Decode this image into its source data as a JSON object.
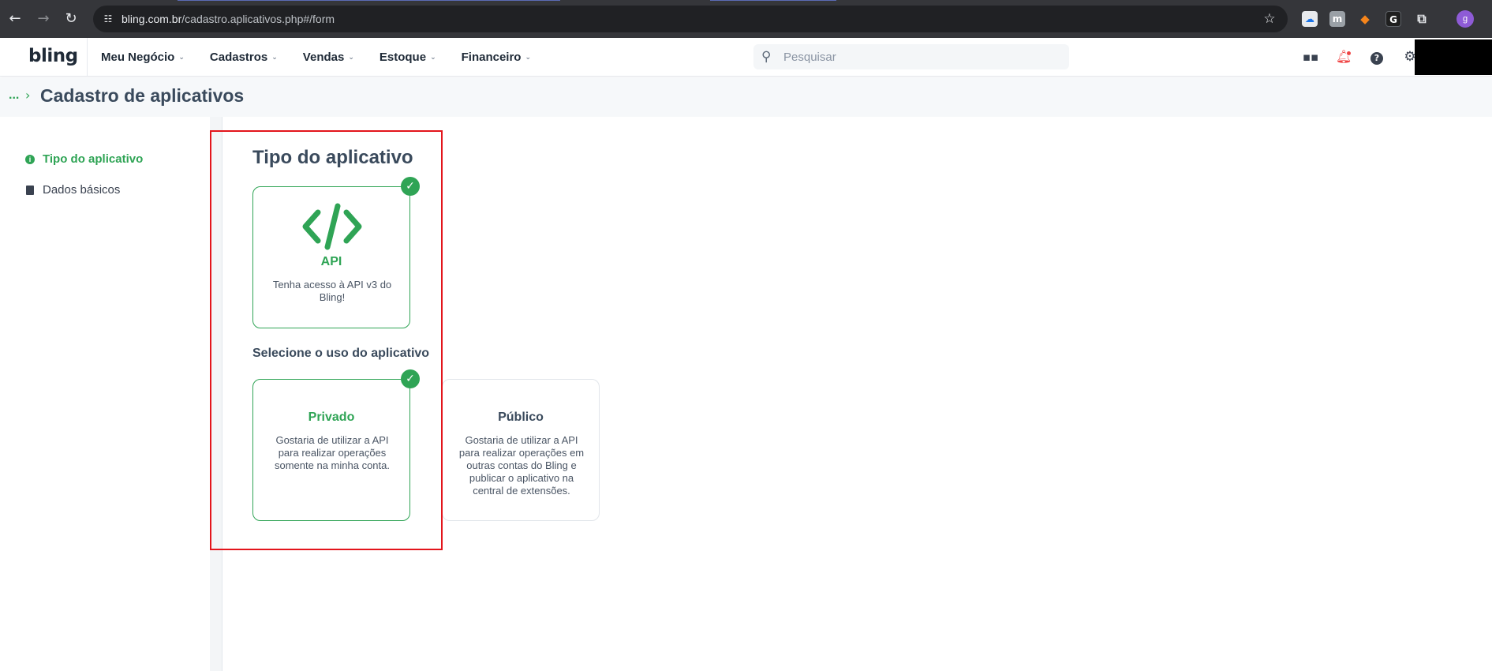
{
  "browser": {
    "url_host": "bling.com.br",
    "url_path": "/cadastro.aplicativos.php#/form",
    "profile_initial": "g"
  },
  "header": {
    "logo": "bling",
    "menu": [
      {
        "label": "Meu Negócio"
      },
      {
        "label": "Cadastros"
      },
      {
        "label": "Vendas"
      },
      {
        "label": "Estoque"
      },
      {
        "label": "Financeiro"
      }
    ],
    "search_placeholder": "Pesquisar"
  },
  "breadcrumb": {
    "ellipsis": "...",
    "title": "Cadastro de aplicativos"
  },
  "sidebar": {
    "items": [
      {
        "label": "Tipo do aplicativo",
        "active": true
      },
      {
        "label": "Dados básicos",
        "active": false
      }
    ]
  },
  "main": {
    "section_title": "Tipo do aplicativo",
    "type_cards": [
      {
        "title": "API",
        "description": "Tenha acesso à API v3 do Bling!",
        "selected": true
      }
    ],
    "usage_title": "Selecione o uso do aplicativo",
    "usage_cards": [
      {
        "title": "Privado",
        "description": "Gostaria de utilizar a API para realizar operações somente na minha conta.",
        "selected": true
      },
      {
        "title": "Público",
        "description": "Gostaria de utilizar a API para realizar operações em outras contas do Bling e publicar o aplicativo na central de extensões.",
        "selected": false
      }
    ]
  },
  "colors": {
    "accent_green": "#2fa455",
    "highlight_red": "#e3151c",
    "title_dark": "#3a4a5c"
  }
}
